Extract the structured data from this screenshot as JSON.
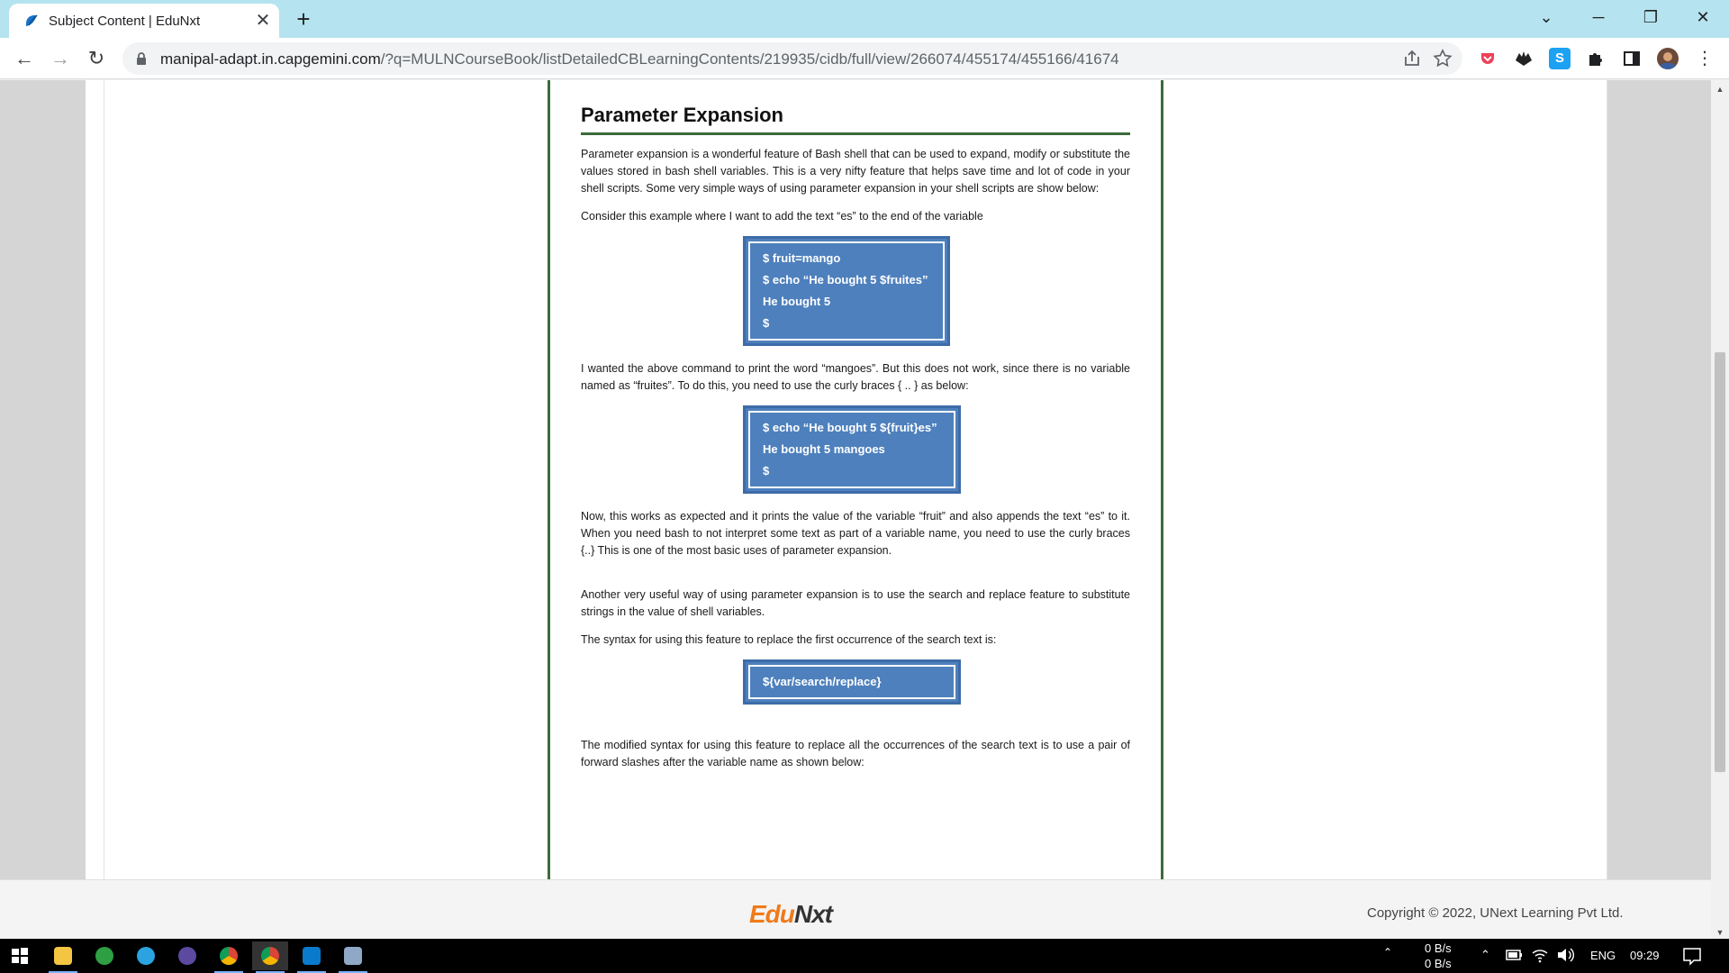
{
  "browser": {
    "tab_title": "Subject Content | EduNxt",
    "tab_close": "✕",
    "new_tab": "+",
    "url_host": "manipal-adapt.in.capgemini.com",
    "url_path": "/?q=MULNCourseBook/listDetailedCBLearningContents/219935/cidb/full/view/266074/455174/455166/41674",
    "window_controls": {
      "tab_list": "⌄",
      "minimize": "─",
      "restore": "❐",
      "close": "✕"
    },
    "nav": {
      "back": "←",
      "forward": "→",
      "reload": "↻",
      "menu": "⋮"
    },
    "extensions": [
      "share-icon",
      "star-icon",
      "pocket-icon",
      "ext-icon",
      "s-icon",
      "puzzle-icon",
      "sidepanel-icon",
      "profile-avatar"
    ]
  },
  "document": {
    "title": "Parameter Expansion",
    "p1": "Parameter expansion is a wonderful feature of Bash shell that can be used to expand, modify or substitute the values stored in bash shell variables. This is a very nifty feature that helps save time and lot of code in your shell scripts. Some very simple ways of using parameter expansion in your shell scripts are show below:",
    "p2": "Consider this example where I want to add the text “es” to the end of the variable",
    "code1": [
      "$ fruit=mango",
      "$ echo “He bought 5 $fruites”",
      "He bought 5",
      "$"
    ],
    "p3": "I wanted the above command to print the word “mangoes”. But this does not work, since there is no variable named as “fruites”. To do this, you need to use the curly braces { .. } as below:",
    "code2": [
      "$ echo “He bought 5 ${fruit}es”",
      "He bought 5 mangoes",
      "$"
    ],
    "p4": "Now, this works as expected and it prints the value of the variable “fruit” and also appends the text “es” to it. When you need bash to not interpret some text as part of a variable name, you need to use the curly braces {..} This is one of the most basic uses of parameter expansion.",
    "p5": "Another very useful way of using parameter expansion is to use the search and replace feature to substitute strings in the value of shell variables.",
    "p6": "The syntax for using this feature to replace the first occurrence of the search text is:",
    "code3": [
      "${var/search/replace}"
    ],
    "p7": "The modified syntax for using this feature to replace all the occurrences of the search text is to use a pair of forward slashes after the variable name as shown below:"
  },
  "footer": {
    "logo_edu": "Edu",
    "logo_nxt": "Nxt",
    "copyright": "Copyright © 2022, UNext Learning Pvt Ltd."
  },
  "taskbar": {
    "net_up": "0 B/s",
    "net_down": "0 B/s",
    "lang": "ENG",
    "time": "09:29"
  },
  "colors": {
    "tabstrip": "#b5e3ef",
    "doc_border": "#3b6b3b",
    "code_bg": "#4e80bd",
    "logo_orange": "#f07a1a"
  }
}
